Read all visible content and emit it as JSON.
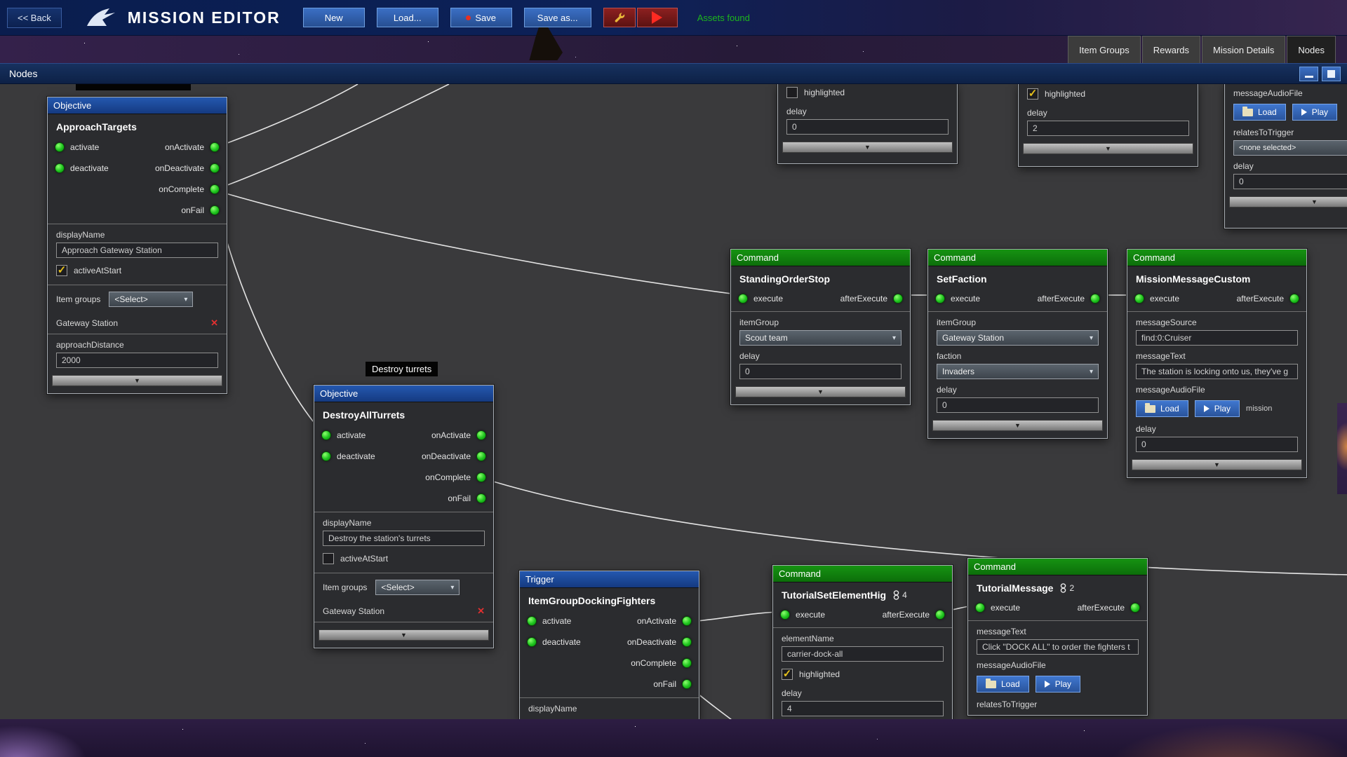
{
  "icons": {
    "dropdown_arrow": "▾",
    "slider_arrow": "▼",
    "red_x": "✕",
    "check": "✓"
  },
  "topbar": {
    "back_label": "<< Back",
    "title": "MISSION EDITOR",
    "new_label": "New",
    "load_label": "Load...",
    "save_label": "Save",
    "save_as_label": "Save as...",
    "assets_status": "Assets found"
  },
  "tabs": {
    "item_groups": "Item Groups",
    "rewards": "Rewards",
    "mission_details": "Mission Details",
    "nodes": "Nodes"
  },
  "panel": {
    "title": "Nodes"
  },
  "labels": {
    "destroy_turrets": "Destroy turrets"
  },
  "ports": {
    "activate": "activate",
    "deactivate": "deactivate",
    "on_activate": "onActivate",
    "on_deactivate": "onDeactivate",
    "on_complete": "onComplete",
    "on_fail": "onFail",
    "execute": "execute",
    "after_execute": "afterExecute"
  },
  "fields": {
    "display_name": "displayName",
    "active_at_start": "activeAtStart",
    "item_groups": "Item groups",
    "approach_distance": "approachDistance",
    "item_group": "itemGroup",
    "faction": "faction",
    "delay": "delay",
    "message_source": "messageSource",
    "message_text": "messageText",
    "message_audio_file": "messageAudioFile",
    "relates_to_trigger": "relatesToTrigger",
    "element_name": "elementName",
    "highlighted": "highlighted",
    "load": "Load",
    "play": "Play"
  },
  "nodes": {
    "approach_targets": {
      "type": "Objective",
      "title": "ApproachTargets",
      "display_name": "Approach Gateway Station",
      "item_groups_value": "<Select>",
      "item_group_entry": "Gateway Station",
      "approach_distance": "2000"
    },
    "destroy_all_turrets": {
      "type": "Objective",
      "title": "DestroyAllTurrets",
      "display_name": "Destroy the station's turrets",
      "item_groups_value": "<Select>",
      "item_group_entry": "Gateway Station"
    },
    "docking_fighters": {
      "type": "Trigger",
      "title": "ItemGroupDockingFighters"
    },
    "standing_order_stop": {
      "type": "Command",
      "title": "StandingOrderStop",
      "item_group_value": "Scout team",
      "delay": "0"
    },
    "set_faction": {
      "type": "Command",
      "title": "SetFaction",
      "item_group_value": "Gateway Station",
      "faction_value": "Invaders",
      "delay": "0"
    },
    "mission_message_custom": {
      "type": "Command",
      "title": "MissionMessageCustom",
      "message_source": "find:0:Cruiser",
      "message_text": "The station is locking onto us, they've g",
      "audio_note": "mission",
      "delay": "0"
    },
    "tutorial_set_element": {
      "type": "Command",
      "title": "TutorialSetElementHig",
      "badge": "4",
      "element_name": "carrier-dock-all",
      "delay": "4"
    },
    "tutorial_message": {
      "type": "Command",
      "title": "TutorialMessage",
      "badge": "2",
      "message_text": "Click \"DOCK ALL\" to order the fighters t"
    },
    "partial_a": {
      "delay": "0"
    },
    "partial_b": {
      "delay": "2"
    },
    "partial_c": {
      "relates_value": "<none selected>",
      "delay": "0"
    }
  }
}
